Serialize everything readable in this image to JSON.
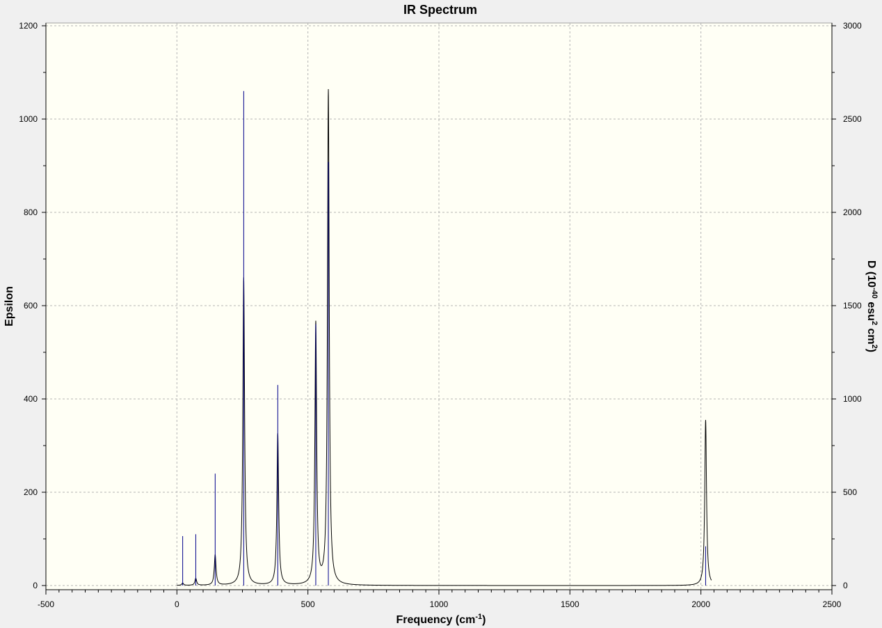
{
  "chart_data": {
    "type": "line",
    "title": "IR Spectrum",
    "xlabel": "Frequency",
    "xlabel_unit": "(cm",
    "xlabel_unit_sup": "-1",
    "xlabel_unit_close": ")",
    "ylabel": "Epsilon",
    "y2label_a": "D (10",
    "y2label_sup1": "-40",
    "y2label_b": " esu",
    "y2label_sup2": "2",
    "y2label_c": " cm",
    "y2label_sup3": "2",
    "y2label_d": ")",
    "xlim": [
      -500,
      2500
    ],
    "ylim": [
      0,
      1200
    ],
    "y2lim": [
      0,
      3000
    ],
    "xticks": [
      -500,
      0,
      500,
      1000,
      1500,
      2000,
      2500
    ],
    "yticks": [
      0,
      200,
      400,
      600,
      800,
      1000,
      1200
    ],
    "y2ticks": [
      0,
      500,
      1000,
      1500,
      2000,
      2500,
      3000
    ],
    "grid": true,
    "colors": {
      "plot_bg": "#fffff5",
      "frame_bg": "#f0f0f0",
      "spectrum": "#000000",
      "sticks": "#00008b",
      "grid": "#b4b4b4"
    },
    "half_width": 4,
    "series": [
      {
        "kind": "spectrum",
        "peaks": [
          {
            "x": 22,
            "eps": 5
          },
          {
            "x": 72,
            "eps": 15
          },
          {
            "x": 146,
            "eps": 65
          },
          {
            "x": 255,
            "eps": 660
          },
          {
            "x": 385,
            "eps": 325
          },
          {
            "x": 530,
            "eps": 560
          },
          {
            "x": 578,
            "eps": 1060
          },
          {
            "x": 2018,
            "eps": 355
          }
        ]
      },
      {
        "kind": "sticks",
        "axis": "D",
        "sticks": [
          {
            "x": 22,
            "d": 265
          },
          {
            "x": 72,
            "d": 275
          },
          {
            "x": 146,
            "d": 600
          },
          {
            "x": 255,
            "d": 2650
          },
          {
            "x": 385,
            "d": 1075
          },
          {
            "x": 530,
            "d": 1400
          },
          {
            "x": 578,
            "d": 2270
          },
          {
            "x": 2018,
            "d": 210
          }
        ]
      }
    ]
  }
}
